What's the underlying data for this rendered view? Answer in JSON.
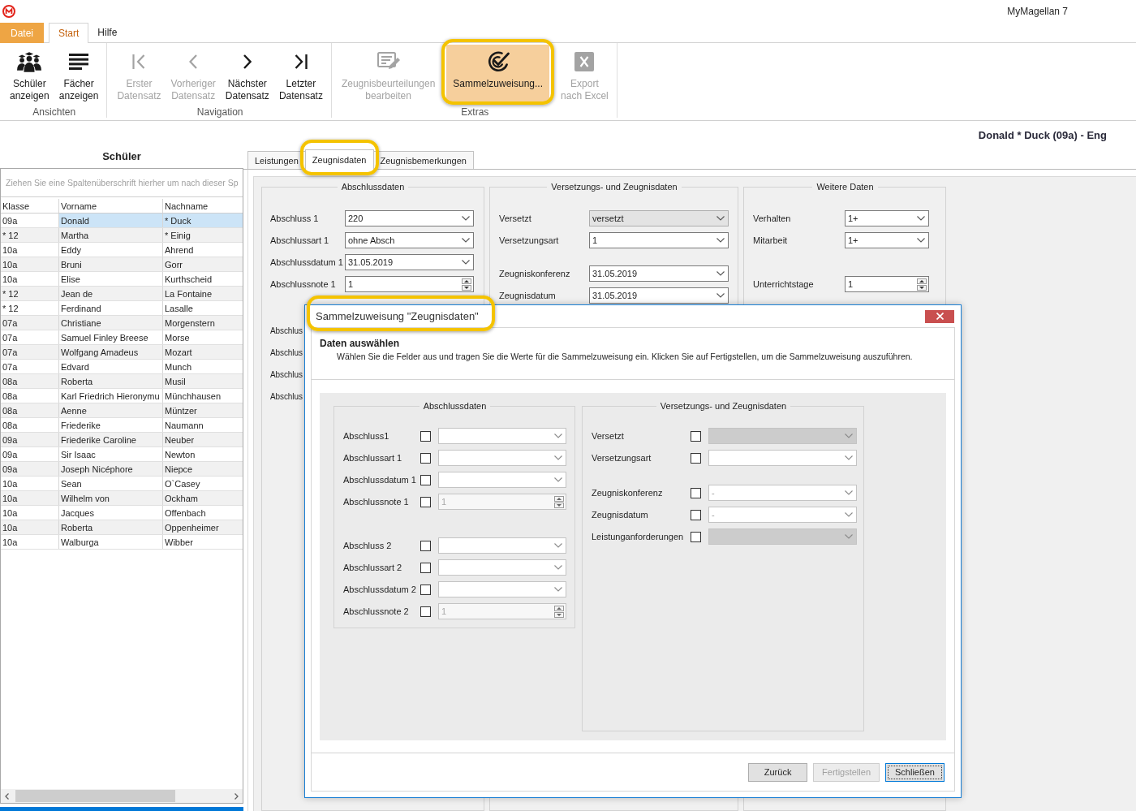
{
  "window": {
    "title": "MyMagellan 7"
  },
  "ribbon": {
    "tabs": [
      {
        "label": "Datei",
        "kind": "file",
        "selected": false
      },
      {
        "label": "Start",
        "kind": "page",
        "selected": true
      },
      {
        "label": "Hilfe",
        "kind": "page",
        "selected": false
      }
    ],
    "groups": [
      {
        "label": "Ansichten",
        "buttons": [
          {
            "kind": "students",
            "lines": [
              "Schüler",
              "anzeigen"
            ],
            "disabled": false,
            "active": false,
            "highlighted": false
          },
          {
            "kind": "subjects",
            "lines": [
              "Fächer",
              "anzeigen"
            ],
            "disabled": false,
            "active": false,
            "highlighted": false
          }
        ]
      },
      {
        "label": "Navigation",
        "buttons": [
          {
            "kind": "first",
            "lines": [
              "Erster",
              "Datensatz"
            ],
            "disabled": true,
            "active": false,
            "highlighted": false
          },
          {
            "kind": "previous",
            "lines": [
              "Vorheriger",
              "Datensatz"
            ],
            "disabled": true,
            "active": false,
            "highlighted": false
          },
          {
            "kind": "next",
            "lines": [
              "Nächster",
              "Datensatz"
            ],
            "disabled": false,
            "active": false,
            "highlighted": false
          },
          {
            "kind": "last",
            "lines": [
              "Letzter",
              "Datensatz"
            ],
            "disabled": false,
            "active": false,
            "highlighted": false
          }
        ]
      },
      {
        "label": "Extras",
        "buttons": [
          {
            "kind": "edit",
            "lines": [
              "Zeugnisbeurteilungen",
              "bearbeiten"
            ],
            "disabled": true,
            "active": false,
            "highlighted": false
          },
          {
            "kind": "assign",
            "lines": [
              "Sammelzuweisung..."
            ],
            "disabled": false,
            "active": true,
            "highlighted": true
          },
          {
            "kind": "excel",
            "lines": [
              "Export",
              "nach Excel"
            ],
            "disabled": true,
            "active": false,
            "highlighted": false
          }
        ]
      }
    ]
  },
  "students": {
    "title": "Schüler",
    "group_hint": "Ziehen Sie eine Spaltenüberschrift hierher um nach dieser Sp",
    "columns": [
      "Klasse",
      "Vorname",
      "Nachname"
    ],
    "rows": [
      {
        "cells": [
          "09a",
          "Donald",
          "* Duck"
        ],
        "selected": true
      },
      {
        "cells": [
          "* 12",
          "Martha",
          "* Einig"
        ],
        "selected": false
      },
      {
        "cells": [
          "10a",
          "Eddy",
          "Ahrend"
        ],
        "selected": false
      },
      {
        "cells": [
          "10a",
          "Bruni",
          "Gorr"
        ],
        "selected": false
      },
      {
        "cells": [
          "10a",
          "Elise",
          "Kurthscheid"
        ],
        "selected": false
      },
      {
        "cells": [
          "* 12",
          "Jean de",
          "La Fontaine"
        ],
        "selected": false
      },
      {
        "cells": [
          "* 12",
          "Ferdinand",
          "Lasalle"
        ],
        "selected": false
      },
      {
        "cells": [
          "07a",
          "Christiane",
          "Morgenstern"
        ],
        "selected": false
      },
      {
        "cells": [
          "07a",
          "Samuel Finley Breese",
          "Morse"
        ],
        "selected": false
      },
      {
        "cells": [
          "07a",
          "Wolfgang Amadeus",
          "Mozart"
        ],
        "selected": false
      },
      {
        "cells": [
          "07a",
          "Edvard",
          "Munch"
        ],
        "selected": false
      },
      {
        "cells": [
          "08a",
          "Roberta",
          "Musil"
        ],
        "selected": false
      },
      {
        "cells": [
          "08a",
          "Karl Friedrich Hieronymu",
          "Münchhausen"
        ],
        "selected": false
      },
      {
        "cells": [
          "08a",
          "Aenne",
          "Müntzer"
        ],
        "selected": false
      },
      {
        "cells": [
          "08a",
          "Friederike",
          "Naumann"
        ],
        "selected": false
      },
      {
        "cells": [
          "09a",
          "Friederike Caroline",
          "Neuber"
        ],
        "selected": false
      },
      {
        "cells": [
          "09a",
          "Sir Isaac",
          "Newton"
        ],
        "selected": false
      },
      {
        "cells": [
          "09a",
          "Joseph Nicéphore",
          "Niepce"
        ],
        "selected": false
      },
      {
        "cells": [
          "10a",
          "Sean",
          "O`Casey"
        ],
        "selected": false
      },
      {
        "cells": [
          "10a",
          "Wilhelm von",
          "Ockham"
        ],
        "selected": false
      },
      {
        "cells": [
          "10a",
          "Jacques",
          "Offenbach"
        ],
        "selected": false
      },
      {
        "cells": [
          "10a",
          "Roberta",
          "Oppenheimer"
        ],
        "selected": false
      },
      {
        "cells": [
          "10a",
          "Walburga",
          "Wibber"
        ],
        "selected": false
      }
    ]
  },
  "record": {
    "title": "Donald * Duck (09a) - Eng"
  },
  "detail": {
    "tabs": [
      {
        "label": "Leistungen",
        "selected": false,
        "highlighted": false
      },
      {
        "label": "Zeugnisdaten",
        "selected": true,
        "highlighted": true
      },
      {
        "label": "Zeugnisbemerkungen",
        "selected": false,
        "highlighted": false
      }
    ],
    "groups": [
      {
        "title": "Abschlussdaten",
        "sections": [
          [
            {
              "label": "Abschluss 1",
              "kind": "combo",
              "value": "220",
              "disabled": false
            },
            {
              "label": "Abschlussart 1",
              "kind": "combo",
              "value": "ohne Absch",
              "disabled": false
            },
            {
              "label": "Abschlussdatum 1",
              "kind": "combo",
              "value": "31.05.2019",
              "disabled": false
            },
            {
              "label": "Abschlussnote 1",
              "kind": "spin",
              "value": "1",
              "disabled": false
            }
          ],
          [
            {
              "label": "Abschlus",
              "kind": "label"
            },
            {
              "label": "Abschlus",
              "kind": "label"
            },
            {
              "label": "Abschlus",
              "kind": "label"
            },
            {
              "label": "Abschlus",
              "kind": "label"
            }
          ]
        ]
      },
      {
        "title": "Versetzungs- und Zeugnisdaten",
        "sections": [
          [
            {
              "label": "Versetzt",
              "kind": "combo",
              "value": "versetzt",
              "disabled": true
            },
            {
              "label": "Versetzungsart",
              "kind": "combo",
              "value": "1",
              "disabled": false
            }
          ],
          [
            {
              "label": "Zeugniskonferenz",
              "kind": "combo",
              "value": "31.05.2019",
              "disabled": false
            },
            {
              "label": "Zeugnisdatum",
              "kind": "combo",
              "value": "31.05.2019",
              "disabled": false
            }
          ]
        ]
      },
      {
        "title": "Weitere Daten",
        "sections": [
          [
            {
              "label": "Verhalten",
              "kind": "combo",
              "value": "1+",
              "disabled": false
            },
            {
              "label": "Mitarbeit",
              "kind": "combo",
              "value": "1+",
              "disabled": false
            }
          ],
          [
            {
              "label": "Unterrichtstage",
              "kind": "spin",
              "value": "1",
              "disabled": false
            }
          ]
        ]
      }
    ]
  },
  "dialog": {
    "title": "Sammelzuweisung \"Zeugnisdaten\"",
    "highlighted": true,
    "heading": "Daten auswählen",
    "description": "Wählen Sie die Felder aus und tragen Sie die Werte für die Sammelzuweisung ein. Klicken Sie auf Fertigstellen, um die Sammelzuweisung auszuführen.",
    "groups": [
      {
        "title": "Abschlussdaten",
        "sections": [
          [
            {
              "label": "Abschluss1",
              "kind": "combo",
              "checked": false,
              "disabled": false
            },
            {
              "label": "Abschlussart 1",
              "kind": "combo",
              "checked": false,
              "disabled": false
            },
            {
              "label": "Abschlussdatum 1",
              "kind": "combo",
              "checked": false,
              "disabled": false
            },
            {
              "label": "Abschlussnote 1",
              "kind": "spin",
              "value": "1",
              "checked": false,
              "disabled": true
            }
          ],
          [
            {
              "label": "Abschluss 2",
              "kind": "combo",
              "checked": false,
              "disabled": false
            },
            {
              "label": "Abschlussart 2",
              "kind": "combo",
              "checked": false,
              "disabled": false
            },
            {
              "label": "Abschlussdatum 2",
              "kind": "combo",
              "checked": false,
              "disabled": false
            },
            {
              "label": "Abschlussnote 2",
              "kind": "spin",
              "value": "1",
              "checked": false,
              "disabled": true
            }
          ]
        ]
      },
      {
        "title": "Versetzungs- und Zeugnisdaten",
        "sections": [
          [
            {
              "label": "Versetzt",
              "kind": "combo",
              "checked": false,
              "disabled": true
            },
            {
              "label": "Versetzungsart",
              "kind": "combo",
              "checked": false,
              "disabled": false
            }
          ],
          [
            {
              "label": "Zeugniskonferenz",
              "kind": "combo",
              "placeholder": "-",
              "checked": false,
              "disabled": false
            },
            {
              "label": "Zeugnisdatum",
              "kind": "combo",
              "placeholder": "-",
              "checked": false,
              "disabled": false
            },
            {
              "label": "Leistunganforderungen",
              "kind": "combo",
              "checked": false,
              "disabled": true
            }
          ]
        ]
      }
    ],
    "buttons": [
      {
        "label": "Zurück",
        "disabled": false,
        "default": false
      },
      {
        "label": "Fertigstellen",
        "disabled": true,
        "default": false
      },
      {
        "label": "Schließen",
        "disabled": false,
        "default": true
      }
    ]
  }
}
